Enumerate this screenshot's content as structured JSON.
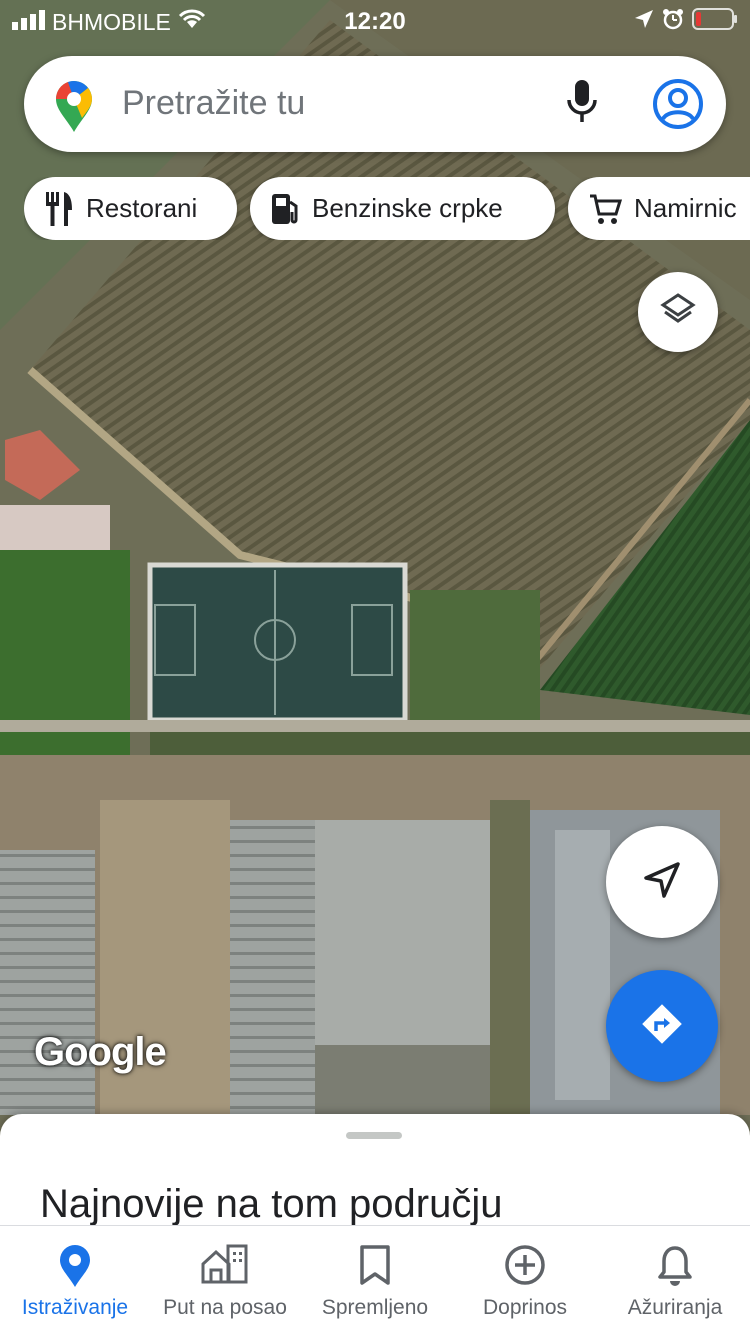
{
  "status_bar": {
    "carrier": "BHMOBILE",
    "time": "12:20"
  },
  "search": {
    "placeholder": "Pretražite tu",
    "icons": [
      "maps-pin-icon",
      "microphone-icon",
      "account-icon"
    ]
  },
  "chips": [
    {
      "label": "Restorani",
      "icon": "restaurant-icon"
    },
    {
      "label": "Benzinske crpke",
      "icon": "gas-station-icon"
    },
    {
      "label": "Namirnic",
      "icon": "shopping-cart-icon"
    }
  ],
  "map": {
    "attribution": "Google",
    "controls": [
      "layers-icon",
      "location-arrow-icon",
      "directions-icon"
    ]
  },
  "sheet": {
    "title": "Najnovije na tom području"
  },
  "nav": [
    {
      "label": "Istraživanje",
      "icon": "explore-pin-icon",
      "active": true
    },
    {
      "label": "Put na posao",
      "icon": "commute-icon",
      "active": false
    },
    {
      "label": "Spremljeno",
      "icon": "bookmark-icon",
      "active": false
    },
    {
      "label": "Doprinos",
      "icon": "add-circle-icon",
      "active": false
    },
    {
      "label": "Ažuriranja",
      "icon": "bell-icon",
      "active": false
    }
  ],
  "colors": {
    "accent": "#1a73e8",
    "battery_low": "#e53935"
  }
}
